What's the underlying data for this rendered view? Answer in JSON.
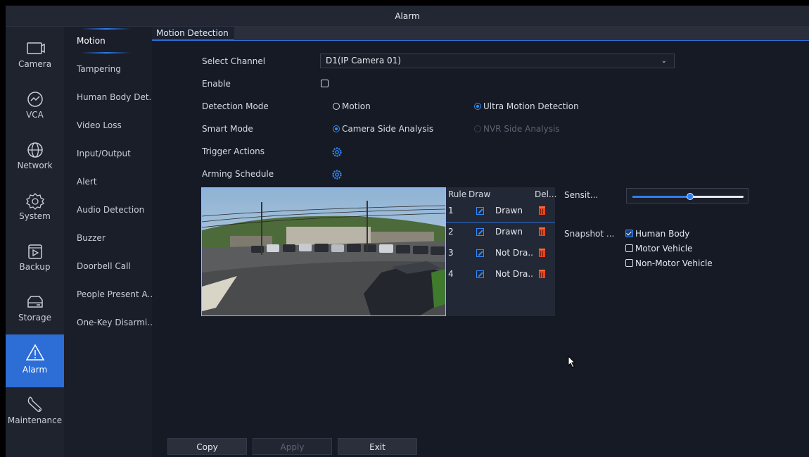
{
  "window": {
    "title": "Alarm"
  },
  "nav": {
    "items": [
      {
        "label": "Camera",
        "icon": "camera-icon"
      },
      {
        "label": "VCA",
        "icon": "vca-icon"
      },
      {
        "label": "Network",
        "icon": "network-icon"
      },
      {
        "label": "System",
        "icon": "gear-icon"
      },
      {
        "label": "Backup",
        "icon": "backup-icon"
      },
      {
        "label": "Storage",
        "icon": "storage-icon"
      },
      {
        "label": "Alarm",
        "icon": "alarm-icon",
        "active": true
      },
      {
        "label": "Maintenance",
        "icon": "wrench-icon"
      }
    ]
  },
  "submenu": {
    "items": [
      {
        "label": "Motion",
        "active": true
      },
      {
        "label": "Tampering"
      },
      {
        "label": "Human Body Det..."
      },
      {
        "label": "Video Loss"
      },
      {
        "label": "Input/Output"
      },
      {
        "label": "Alert"
      },
      {
        "label": "Audio Detection"
      },
      {
        "label": "Buzzer"
      },
      {
        "label": "Doorbell Call"
      },
      {
        "label": "People Present A..."
      },
      {
        "label": "One-Key Disarmi.."
      }
    ]
  },
  "tab": {
    "label": "Motion Detection"
  },
  "form": {
    "select_channel_label": "Select Channel",
    "select_channel_value": "D1(IP Camera 01)",
    "enable_label": "Enable",
    "enable_checked": false,
    "detection_mode_label": "Detection Mode",
    "detection_mode_options": [
      "Motion",
      "Ultra Motion Detection"
    ],
    "detection_mode_selected": "Ultra Motion Detection",
    "smart_mode_label": "Smart Mode",
    "smart_mode_options": [
      "Camera Side Analysis",
      "NVR Side Analysis"
    ],
    "smart_mode_selected": "Camera Side Analysis",
    "trigger_actions_label": "Trigger Actions",
    "arming_schedule_label": "Arming Schedule"
  },
  "rule_table": {
    "headers": {
      "rule": "Rule",
      "draw": "Draw",
      "delete": "Del..."
    },
    "rows": [
      {
        "rule": "1",
        "status": "Drawn"
      },
      {
        "rule": "2",
        "status": "Drawn"
      },
      {
        "rule": "3",
        "status": "Not Dra.."
      },
      {
        "rule": "4",
        "status": "Not Dra.."
      }
    ]
  },
  "sensitivity": {
    "label": "Sensit...",
    "value_fraction": 0.52
  },
  "snapshot": {
    "label": "Snapshot ...",
    "options": [
      {
        "label": "Human Body",
        "checked": true
      },
      {
        "label": "Motor Vehicle",
        "checked": false
      },
      {
        "label": "Non-Motor Vehicle",
        "checked": false
      }
    ]
  },
  "buttons": {
    "copy": "Copy",
    "apply": "Apply",
    "exit": "Exit"
  },
  "colors": {
    "accent": "#2c6dd6",
    "preview_border": "#d4c21a",
    "delete_icon": "#e8441c"
  }
}
